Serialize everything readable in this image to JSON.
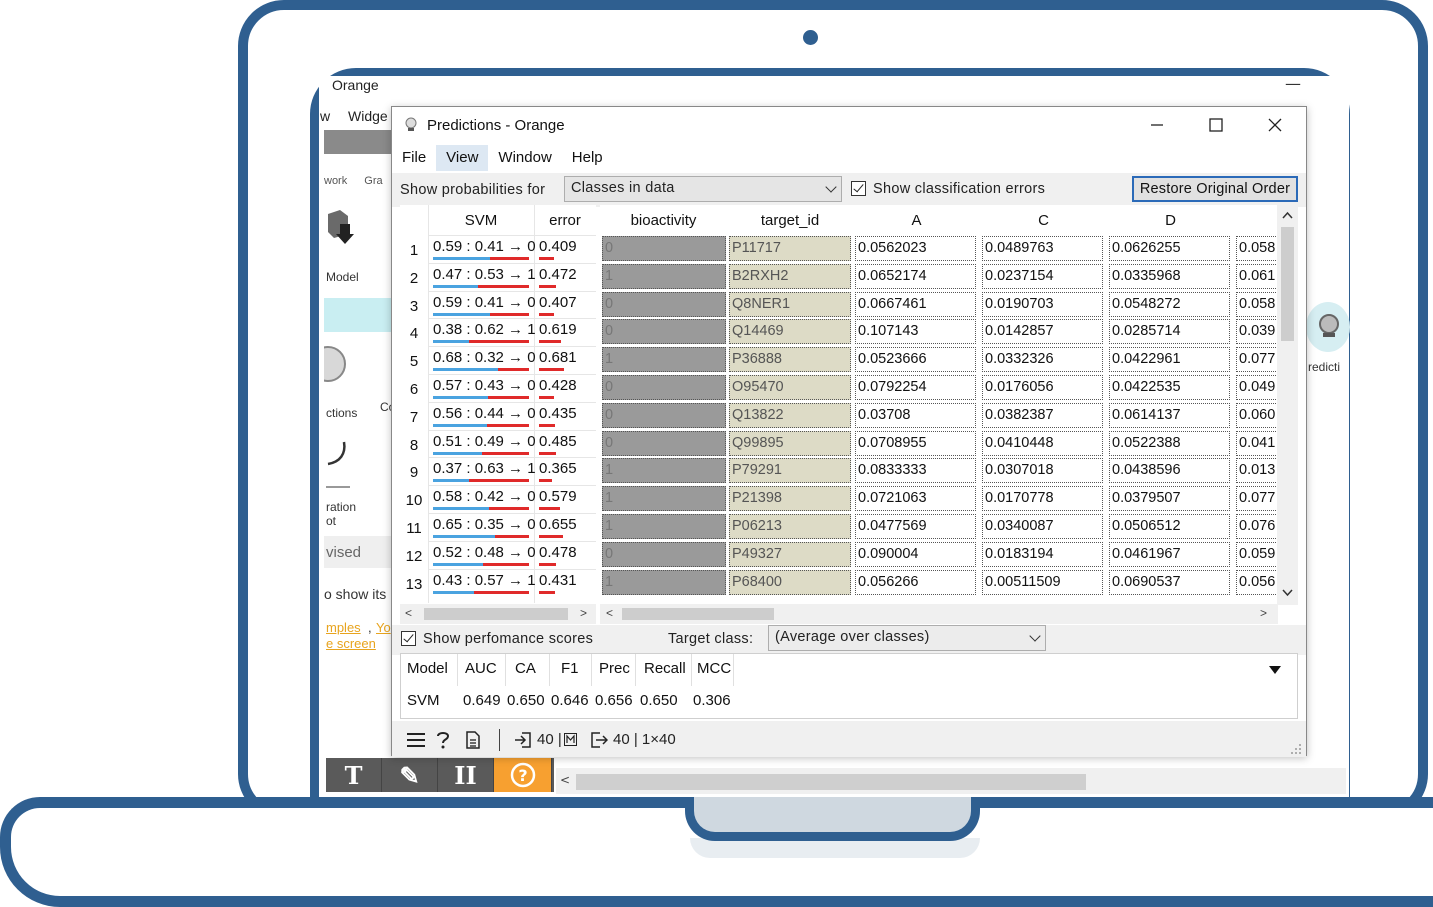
{
  "background_app": {
    "title": "Orange",
    "menu": [
      "w",
      "Widge"
    ],
    "tabs": [
      "work",
      "Gra"
    ],
    "labels": {
      "model": "Model",
      "predictions_partial": "ctions",
      "co": "Co",
      "calibration_line1": "ration",
      "calibration_line2": "ot",
      "unsupervised": "vised",
      "show_its": "o show its",
      "predictions_right": "redicti"
    },
    "links": {
      "line1_a": "mples",
      "line1_sep": ",",
      "line1_b": "Yo",
      "line2": "e screen"
    },
    "bottom_toolbar": [
      "T",
      "✎",
      "II",
      "?"
    ]
  },
  "dialog": {
    "title": "Predictions - Orange",
    "menu": [
      "File",
      "View",
      "Window",
      "Help"
    ],
    "active_menu": "View",
    "show_probabilities_label": "Show probabilities for",
    "probabilities_value": "Classes in data",
    "show_errors_label": "Show classification errors",
    "restore_button": "Restore Original Order",
    "pred_headers": {
      "model": "SVM",
      "error": "error"
    },
    "data_headers": [
      "bioactivity",
      "target_id",
      "A",
      "C",
      "D"
    ],
    "rows": [
      {
        "n": "1",
        "pred": "0.59 : 0.41 → 0",
        "p0": 0.59,
        "error": "0.409",
        "err": 0.409,
        "bio": "0",
        "tid": "P11717",
        "A": "0.0562023",
        "C": "0.0489763",
        "D": "0.0626255",
        "E": "0.058"
      },
      {
        "n": "2",
        "pred": "0.47 : 0.53 → 1",
        "p0": 0.47,
        "error": "0.472",
        "err": 0.472,
        "bio": "1",
        "tid": "B2RXH2",
        "A": "0.0652174",
        "C": "0.0237154",
        "D": "0.0335968",
        "E": "0.061"
      },
      {
        "n": "3",
        "pred": "0.59 : 0.41 → 0",
        "p0": 0.59,
        "error": "0.407",
        "err": 0.407,
        "bio": "0",
        "tid": "Q8NER1",
        "A": "0.0667461",
        "C": "0.0190703",
        "D": "0.0548272",
        "E": "0.058"
      },
      {
        "n": "4",
        "pred": "0.38 : 0.62 → 1",
        "p0": 0.38,
        "error": "0.619",
        "err": 0.619,
        "bio": "0",
        "tid": "Q14469",
        "A": "0.107143",
        "C": "0.0142857",
        "D": "0.0285714",
        "E": "0.039"
      },
      {
        "n": "5",
        "pred": "0.68 : 0.32 → 0",
        "p0": 0.68,
        "error": "0.681",
        "err": 0.681,
        "bio": "1",
        "tid": "P36888",
        "A": "0.0523666",
        "C": "0.0332326",
        "D": "0.0422961",
        "E": "0.077"
      },
      {
        "n": "6",
        "pred": "0.57 : 0.43 → 0",
        "p0": 0.57,
        "error": "0.428",
        "err": 0.428,
        "bio": "0",
        "tid": "O95470",
        "A": "0.0792254",
        "C": "0.0176056",
        "D": "0.0422535",
        "E": "0.049"
      },
      {
        "n": "7",
        "pred": "0.56 : 0.44 → 0",
        "p0": 0.56,
        "error": "0.435",
        "err": 0.435,
        "bio": "0",
        "tid": "Q13822",
        "A": "0.03708",
        "C": "0.0382387",
        "D": "0.0614137",
        "E": "0.060"
      },
      {
        "n": "8",
        "pred": "0.51 : 0.49 → 0",
        "p0": 0.51,
        "error": "0.485",
        "err": 0.485,
        "bio": "0",
        "tid": "Q99895",
        "A": "0.0708955",
        "C": "0.0410448",
        "D": "0.0522388",
        "E": "0.041"
      },
      {
        "n": "9",
        "pred": "0.37 : 0.63 → 1",
        "p0": 0.37,
        "error": "0.365",
        "err": 0.365,
        "bio": "1",
        "tid": "P79291",
        "A": "0.0833333",
        "C": "0.0307018",
        "D": "0.0438596",
        "E": "0.013"
      },
      {
        "n": "10",
        "pred": "0.58 : 0.42 → 0",
        "p0": 0.58,
        "error": "0.579",
        "err": 0.579,
        "bio": "1",
        "tid": "P21398",
        "A": "0.0721063",
        "C": "0.0170778",
        "D": "0.0379507",
        "E": "0.077"
      },
      {
        "n": "11",
        "pred": "0.65 : 0.35 → 0",
        "p0": 0.65,
        "error": "0.655",
        "err": 0.655,
        "bio": "1",
        "tid": "P06213",
        "A": "0.0477569",
        "C": "0.0340087",
        "D": "0.0506512",
        "E": "0.076"
      },
      {
        "n": "12",
        "pred": "0.52 : 0.48 → 0",
        "p0": 0.52,
        "error": "0.478",
        "err": 0.478,
        "bio": "0",
        "tid": "P49327",
        "A": "0.090004",
        "C": "0.0183194",
        "D": "0.0461967",
        "E": "0.059"
      },
      {
        "n": "13",
        "pred": "0.43 : 0.57 → 1",
        "p0": 0.43,
        "error": "0.431",
        "err": 0.431,
        "bio": "1",
        "tid": "P68400",
        "A": "0.056266",
        "C": "0.00511509",
        "D": "0.0690537",
        "E": "0.056"
      }
    ],
    "show_performance_label": "Show perfomance scores",
    "target_class_label": "Target class:",
    "target_class_value": "(Average over classes)",
    "score_headers": [
      "Model",
      "AUC",
      "CA",
      "F1",
      "Prec",
      "Recall",
      "MCC"
    ],
    "score_row": [
      "SVM",
      "0.649",
      "0.650",
      "0.646",
      "0.656",
      "0.650",
      "0.306"
    ],
    "status": {
      "input": "40 | ",
      "output": "40 | 1×40"
    },
    "colors": {
      "bar_blue": "#4aa3e0",
      "bar_red": "#e02a2a",
      "bioactivity_bg": "#9a9a9a",
      "target_id_bg": "#dddbc6",
      "laptop": "#2f5f90",
      "help_orange": "#f7a030"
    }
  }
}
